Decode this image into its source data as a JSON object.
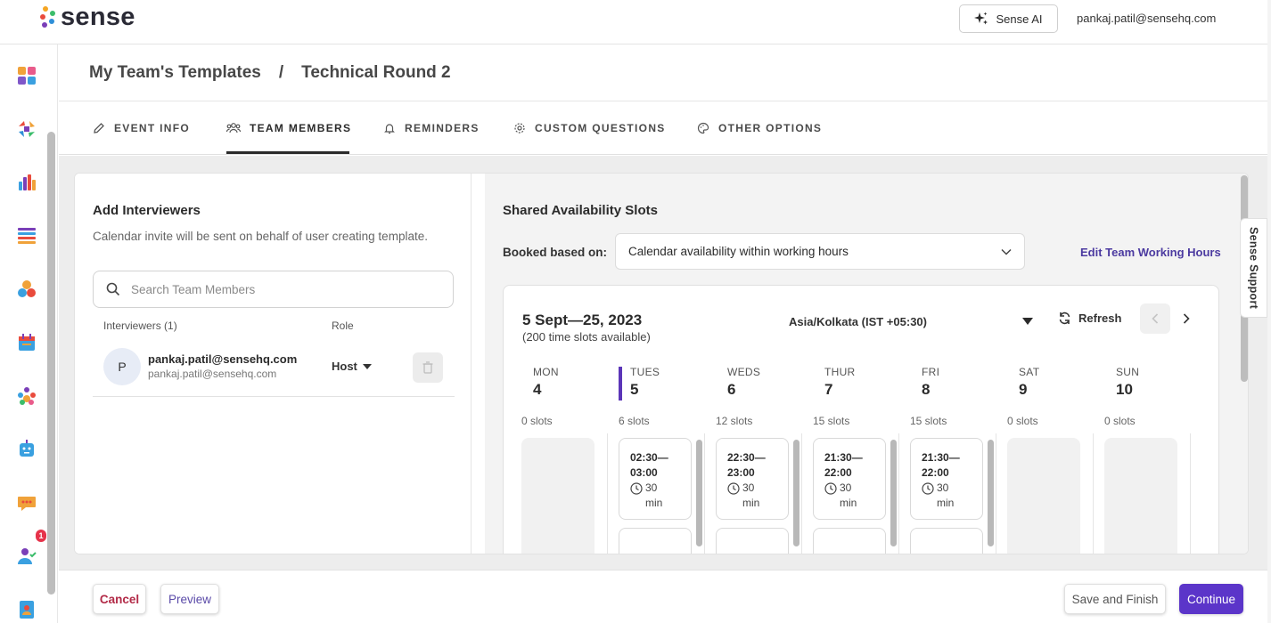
{
  "brand": {
    "name": "sense"
  },
  "topbar": {
    "ai_button": "Sense AI",
    "user_email": "pankaj.patil@sensehq.com"
  },
  "sidebar": {
    "icons": [
      "dashboard-icon",
      "workflow-icon",
      "analytics-icon",
      "lists-icon",
      "engage-icon",
      "calendar-icon",
      "people-icon",
      "chatbot-icon",
      "messages-icon",
      "user-check-icon",
      "contacts-book-icon"
    ],
    "messages_badge": "1"
  },
  "breadcrumb": {
    "parent": "My Team's Templates",
    "separator": "/",
    "current": "Technical Round 2"
  },
  "tabs": [
    {
      "label": "EVENT INFO",
      "icon": "pencil-icon"
    },
    {
      "label": "TEAM MEMBERS",
      "icon": "team-icon",
      "active": true
    },
    {
      "label": "REMINDERS",
      "icon": "bell-icon"
    },
    {
      "label": "CUSTOM QUESTIONS",
      "icon": "gear-icon"
    },
    {
      "label": "OTHER OPTIONS",
      "icon": "palette-icon"
    }
  ],
  "interviewers": {
    "title": "Add Interviewers",
    "subtitle": "Calendar invite will be sent on behalf of user creating template.",
    "search_placeholder": "Search Team Members",
    "col_interviewers": "Interviewers (1)",
    "col_role": "Role",
    "members": [
      {
        "initial": "P",
        "name": "pankaj.patil@sensehq.com",
        "email": "pankaj.patil@sensehq.com",
        "role": "Host"
      }
    ]
  },
  "availability": {
    "title": "Shared Availability Slots",
    "booked_label": "Booked based on:",
    "booked_value": "Calendar availability within working hours",
    "edit_link": "Edit Team Working Hours",
    "range": "5 Sept—25, 2023",
    "range_sub": "(200 time slots available)",
    "timezone": "Asia/Kolkata (IST +05:30)",
    "refresh": "Refresh",
    "days": [
      {
        "name": "MON",
        "num": "4",
        "slots": "0 slots"
      },
      {
        "name": "TUES",
        "num": "5",
        "slots": "6 slots",
        "active": true,
        "slot_start": "02:30—",
        "slot_end": "03:00"
      },
      {
        "name": "WEDS",
        "num": "6",
        "slots": "12 slots",
        "slot_start": "22:30—",
        "slot_end": "23:00"
      },
      {
        "name": "THUR",
        "num": "7",
        "slots": "15 slots",
        "slot_start": "21:30—",
        "slot_end": "22:00"
      },
      {
        "name": "FRI",
        "num": "8",
        "slots": "15 slots",
        "slot_start": "21:30—",
        "slot_end": "22:00"
      },
      {
        "name": "SAT",
        "num": "9",
        "slots": "0 slots"
      },
      {
        "name": "SUN",
        "num": "10",
        "slots": "0 slots"
      }
    ],
    "slot_duration": "30",
    "slot_unit": "min"
  },
  "support": {
    "label": "Sense Support"
  },
  "footer": {
    "cancel": "Cancel",
    "preview": "Preview",
    "save": "Save and Finish",
    "continue": "Continue"
  },
  "colors": {
    "accent": "#5b35c9",
    "cancel": "#b22a47",
    "link": "#4b3aa0",
    "active_day": "#5b35b8"
  }
}
